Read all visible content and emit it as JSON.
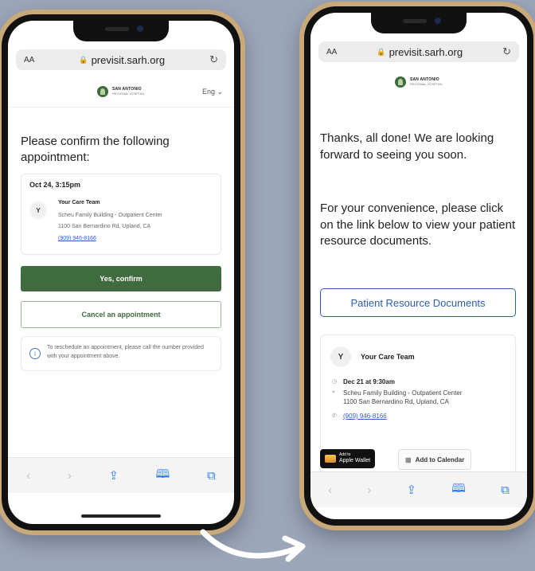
{
  "left_phone": {
    "browser": {
      "aa": "AA",
      "url": "previsit.sarh.org",
      "reload_icon": "reload-icon"
    },
    "logo": {
      "line1": "SAN ANTONIO",
      "line2": "REGIONAL HOSPITAL"
    },
    "lang": "Eng ⌄",
    "heading": "Please confirm the following appointment:",
    "appointment": {
      "datetime": "Oct 24, 3:15pm",
      "avatar": "Y",
      "team": "Your Care Team",
      "location": "Scheu Family Building - Outpatient Center",
      "address": "1100 San Bernardino Rd, Upland, CA",
      "phone": "(909) 946-8166"
    },
    "confirm_label": "Yes, confirm",
    "cancel_label": "Cancel an appointment",
    "info_text": "To reschedule an appointment, please call the number provided with your appointment above.",
    "toolbar": {
      "back": "‹",
      "forward": "›",
      "share": "⇪",
      "bookmarks": "🕮",
      "tabs": "⧉"
    }
  },
  "right_phone": {
    "browser": {
      "aa": "AA",
      "url": "previsit.sarh.org",
      "reload_icon": "reload-icon"
    },
    "logo": {
      "line1": "SAN ANTONIO",
      "line2": "REGIONAL HOSPITAL"
    },
    "message1": "Thanks, all done! We are looking forward to seeing you soon.",
    "message2": "For your convenience, please click on the link below to view your patient resource documents.",
    "resource_button": "Patient Resource Documents",
    "appointment": {
      "avatar": "Y",
      "team": "Your Care Team",
      "datetime": "Dec 21 at 9:30am",
      "location": "Scheu Family Building - Outpatient Center",
      "address": "1100 San Bernardino Rd, Upland, CA",
      "phone": "(909) 946-8166"
    },
    "wallet_small": "Add to",
    "wallet_label": "Apple Wallet",
    "calendar_label": "Add to Calendar",
    "toolbar": {
      "back": "‹",
      "forward": "›",
      "share": "⇪",
      "bookmarks": "🕮",
      "tabs": "⧉"
    }
  },
  "colors": {
    "primary_green": "#3f6b3e",
    "link_blue": "#2b5fae",
    "background": "#9ca6b9"
  }
}
